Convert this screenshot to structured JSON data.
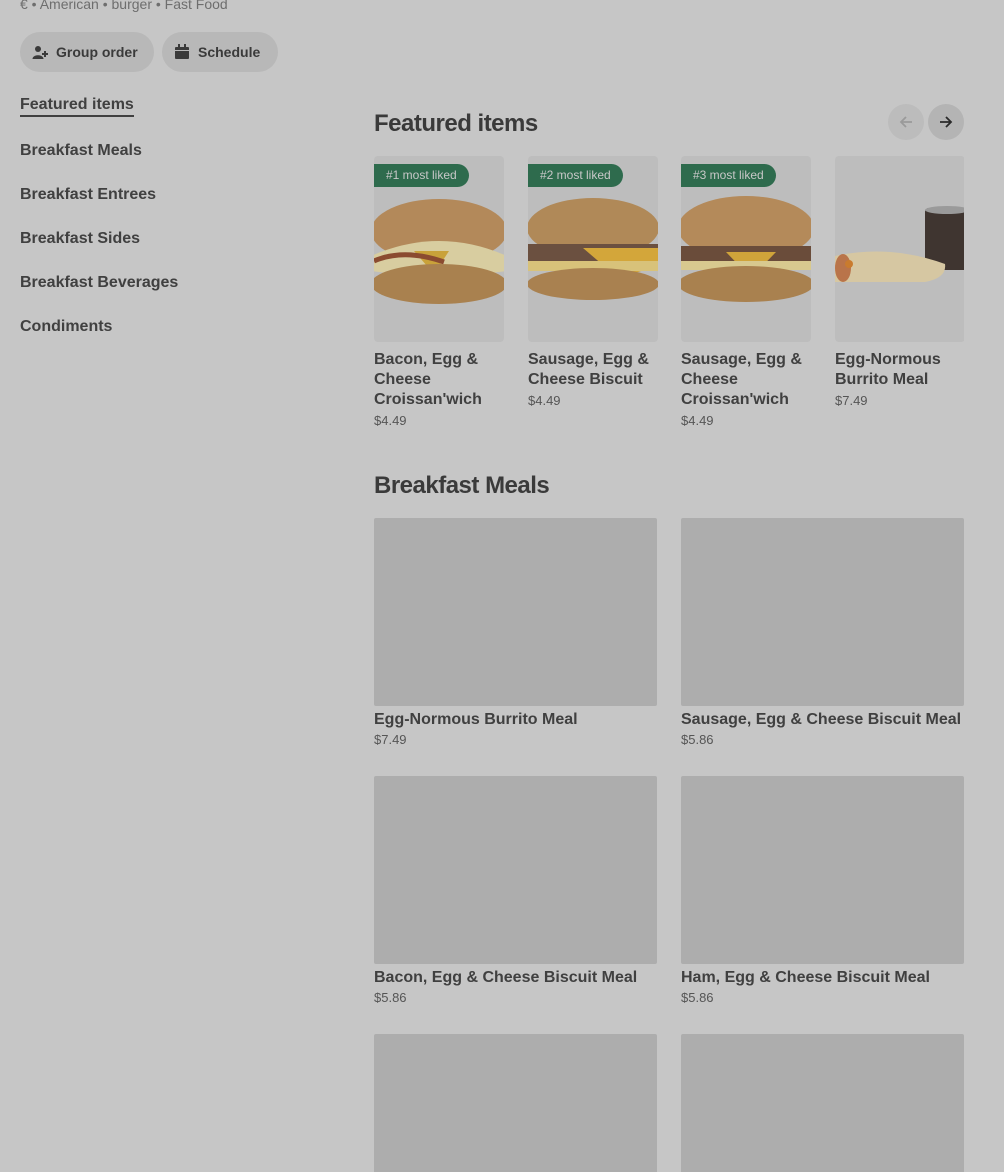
{
  "header": {
    "meta": "€ • American • burger • Fast Food",
    "group_order": "Group order",
    "schedule": "Schedule"
  },
  "sidebar": {
    "items": [
      {
        "label": "Featured items"
      },
      {
        "label": "Breakfast Meals"
      },
      {
        "label": "Breakfast Entrees"
      },
      {
        "label": "Breakfast Sides"
      },
      {
        "label": "Breakfast Beverages"
      },
      {
        "label": "Condiments"
      }
    ]
  },
  "featured": {
    "title": "Featured items",
    "items": [
      {
        "badge": "#1 most liked",
        "name": "Bacon, Egg & Cheese Croissan'wich",
        "price": "$4.49"
      },
      {
        "badge": "#2 most liked",
        "name": "Sausage, Egg & Cheese Biscuit",
        "price": "$4.49"
      },
      {
        "badge": "#3 most liked",
        "name": "Sausage, Egg & Cheese Croissan'wich",
        "price": "$4.49"
      },
      {
        "badge": "",
        "name": "Egg-Normous Burrito Meal",
        "price": "$7.49"
      }
    ]
  },
  "breakfast_meals": {
    "title": "Breakfast Meals",
    "items": [
      {
        "name": "Egg-Normous Burrito Meal",
        "price": "$7.49"
      },
      {
        "name": "Sausage, Egg & Cheese Biscuit Meal",
        "price": "$5.86"
      },
      {
        "name": "Bacon, Egg & Cheese Biscuit Meal",
        "price": "$5.86"
      },
      {
        "name": "Ham, Egg & Cheese Biscuit Meal",
        "price": "$5.86"
      }
    ]
  },
  "colors": {
    "badge": "#2e6b4d",
    "background": "#c6c6c6"
  }
}
